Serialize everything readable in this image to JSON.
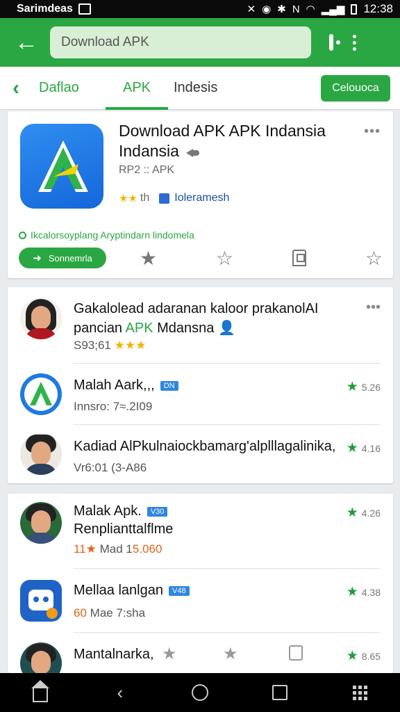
{
  "status_bar": {
    "carrier": "Sarimdeas",
    "time": "12:38"
  },
  "toolbar": {
    "search_value": "Download APK"
  },
  "tabs": [
    {
      "label": "Daflao"
    },
    {
      "label": "APK"
    },
    {
      "label": "Indesis"
    }
  ],
  "tab_button": "Celouoca",
  "hero": {
    "title": "Download APK APK Indansia Indansia",
    "subtitle": "RP2 :: APK",
    "rating_suffix": "th",
    "developer": "Ioleramesh",
    "description": "Ikcalorsoyplang Aryptindarn lindomela",
    "button": "Sonnemrla"
  },
  "list1": [
    {
      "title_line1": "Gakalolead adaranan kaloor prakanolAI",
      "title_line2a": "pancian ",
      "title_line2b": "APK",
      "title_line2c": " Mdansna",
      "meta": "S93;61"
    },
    {
      "title": "Malah Aark,,,",
      "tag": "DN",
      "meta": "Innsro: 7≈.2I09",
      "score": "5.26"
    },
    {
      "title": "Kadiad AlPkulnaiockbamarg'alplllagalinika,",
      "meta": "Vr6:01 (3-A86",
      "score": "4.16"
    }
  ],
  "list2": [
    {
      "title": "Malak Apk.",
      "tag": "V30",
      "subtitle": "Renplianttalflme",
      "meta_a": "11",
      "meta_b": "Mad 1",
      "meta_c": "5.060",
      "score": "4.26"
    },
    {
      "title": "Mellaa lanlgan",
      "tag": "V48",
      "meta_a": "60",
      "meta_b": "Mae 7:sha",
      "score": "4.38"
    },
    {
      "title": "Mantalnarka,",
      "score": "8.65"
    }
  ],
  "colors": {
    "brand_green": "#2aa742",
    "accent_blue": "#2f86e0",
    "star_yellow": "#f2b400"
  }
}
